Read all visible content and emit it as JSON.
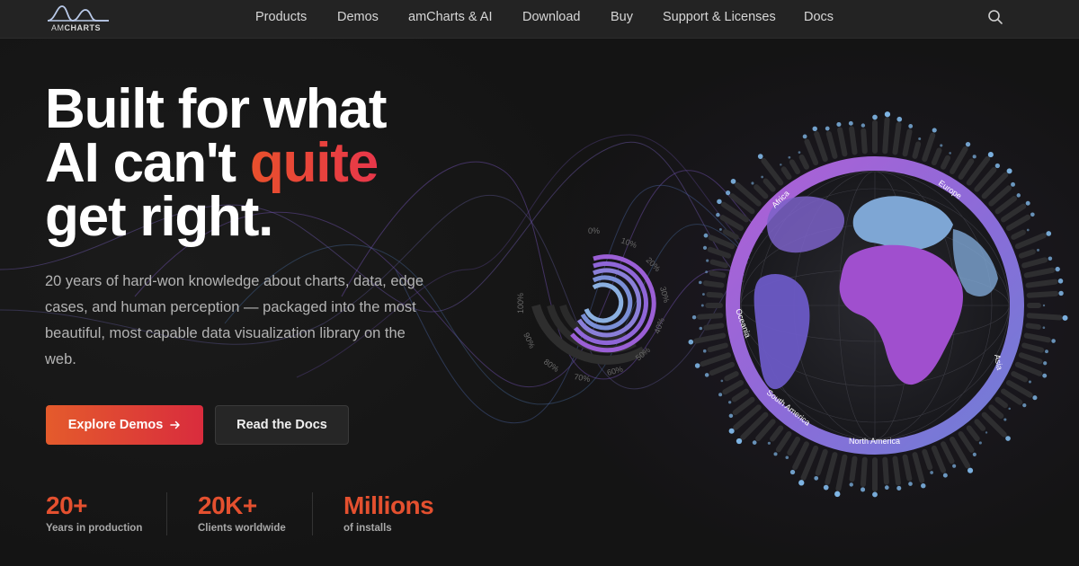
{
  "brand": {
    "logo_text_light": "AM",
    "logo_text_bold": "CHARTS"
  },
  "nav": {
    "items": [
      {
        "label": "Products"
      },
      {
        "label": "Demos"
      },
      {
        "label": "amCharts & AI"
      },
      {
        "label": "Download"
      },
      {
        "label": "Buy"
      },
      {
        "label": "Support & Licenses"
      },
      {
        "label": "Docs"
      }
    ],
    "search_icon": "search-icon"
  },
  "hero": {
    "line1": "Built for what",
    "line2_prefix": "AI can't ",
    "line2_accent": "quite",
    "line3": "get right.",
    "subtext": "20 years of hard-won knowledge about charts, data, edge cases, and human perception — packaged into the most beautiful, most capable data visualization library on the web.",
    "primary_button": "Explore Demos",
    "primary_button_icon": "arrow-right-icon",
    "secondary_button": "Read the Docs"
  },
  "stats": [
    {
      "value": "20+",
      "label": "Years in production"
    },
    {
      "value": "20K+",
      "label": "Clients worldwide"
    },
    {
      "value": "Millions",
      "label": "of installs"
    }
  ],
  "gauge": {
    "labels": [
      "0%",
      "10%",
      "20%",
      "30%",
      "40%",
      "50%",
      "60%",
      "70%",
      "80%",
      "90%",
      "100%"
    ]
  },
  "globe": {
    "regions": [
      "Africa",
      "Europe",
      "Asia",
      "North America",
      "South America",
      "Oceania"
    ]
  },
  "colors": {
    "background": "#141414",
    "nav_background": "#232323",
    "accent": "#e4502f",
    "purple": "#9b5fd6",
    "blue": "#6a8fd0"
  }
}
